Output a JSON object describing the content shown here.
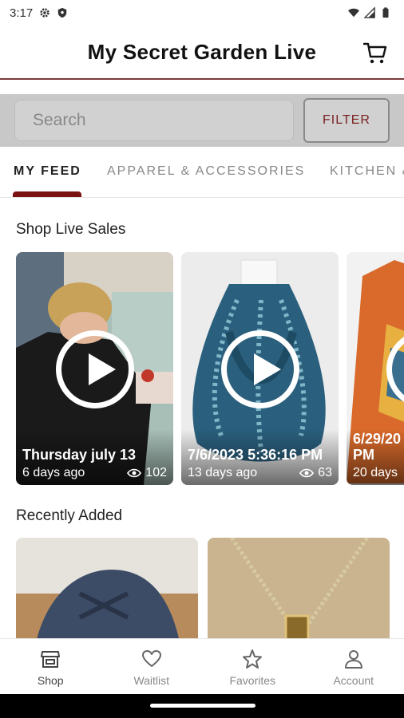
{
  "status": {
    "time": "3:17"
  },
  "header": {
    "title": "My Secret Garden Live"
  },
  "search": {
    "placeholder": "Search",
    "filter_label": "FILTER"
  },
  "tabs": [
    {
      "label": "MY FEED"
    },
    {
      "label": "APPAREL & ACCESSORIES"
    },
    {
      "label": "KITCHEN &"
    }
  ],
  "live": {
    "title": "Shop Live Sales",
    "cards": [
      {
        "title": "Thursday july 13",
        "ago": "6 days ago",
        "views": "102"
      },
      {
        "title": "7/6/2023 5:36:16 PM",
        "ago": "13 days ago",
        "views": "63"
      },
      {
        "title": "6/29/20 PM",
        "ago": "20 days",
        "views": ""
      }
    ]
  },
  "recent": {
    "title": "Recently Added"
  },
  "nav": [
    {
      "label": "Shop",
      "icon": "shop-icon"
    },
    {
      "label": "Waitlist",
      "icon": "heart-icon"
    },
    {
      "label": "Favorites",
      "icon": "star-icon"
    },
    {
      "label": "Account",
      "icon": "account-icon"
    }
  ]
}
